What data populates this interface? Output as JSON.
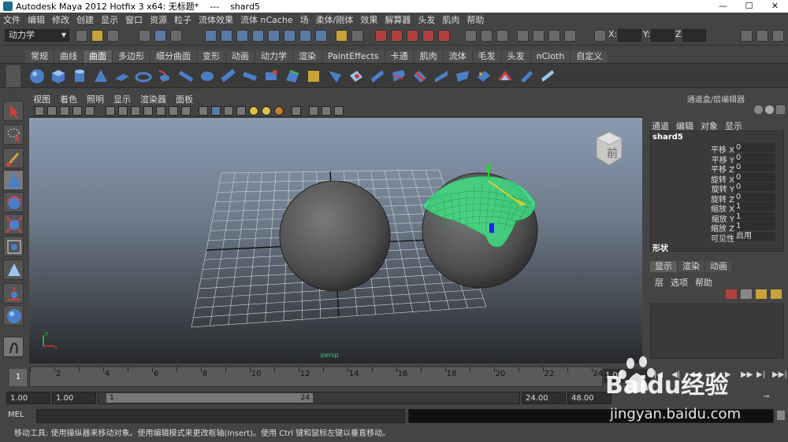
{
  "window": {
    "title": "Autodesk Maya 2012 Hotfix 3 x64: 无标题*    ---    shard5",
    "controls": [
      "—",
      "☐",
      "✕"
    ]
  },
  "menubar": [
    "文件",
    "编辑",
    "修改",
    "创建",
    "显示",
    "窗口",
    "资源",
    "粒子",
    "流体效果",
    "流体 nCache",
    "场",
    "柔体/刚体",
    "效果",
    "解算器",
    "头发",
    "肌肉",
    "帮助"
  ],
  "statusline": {
    "mode": "动力学",
    "x_label": "X:",
    "y_label": "Y:",
    "z_label": "Z:"
  },
  "shelf_tabs": [
    "常规",
    "曲线",
    "曲面",
    "多边形",
    "细分曲面",
    "变形",
    "动画",
    "动力学",
    "渲染",
    "PaintEffects",
    "卡通",
    "肌肉",
    "流体",
    "毛发",
    "头发",
    "nCloth",
    "自定义"
  ],
  "shelf_active": "曲面",
  "panel_menu": [
    "视图",
    "着色",
    "照明",
    "显示",
    "渲染器",
    "面板"
  ],
  "viewport": {
    "viewcube_label": "前",
    "hud_bottom": "persp"
  },
  "channel_box": {
    "title": "通道盒/层编辑器",
    "menu": [
      "通道",
      "编辑",
      "对象",
      "显示"
    ],
    "node": "shard5",
    "attributes": [
      {
        "label": "平移 X",
        "value": "0"
      },
      {
        "label": "平移 Y",
        "value": "0"
      },
      {
        "label": "平移 Z",
        "value": "0"
      },
      {
        "label": "旋转 X",
        "value": "0"
      },
      {
        "label": "旋转 Y",
        "value": "0"
      },
      {
        "label": "旋转 Z",
        "value": "0"
      },
      {
        "label": "缩放 X",
        "value": "1"
      },
      {
        "label": "缩放 Y",
        "value": "1"
      },
      {
        "label": "缩放 Z",
        "value": "1"
      },
      {
        "label": "可见性",
        "value": "启用"
      }
    ],
    "shape_label": "形状"
  },
  "layer_editor": {
    "tabs": [
      "显示",
      "渲染",
      "动画"
    ],
    "menu": [
      "层",
      "选项",
      "帮助"
    ]
  },
  "timeslider": {
    "ticks": [
      "2",
      "4",
      "6",
      "8",
      "10",
      "12",
      "14",
      "16",
      "18",
      "20",
      "22",
      "24"
    ],
    "current_frame": "1",
    "right_value": "1.00"
  },
  "range_slider": {
    "start_time": "1.00",
    "start_range": "1.00",
    "thumb_start": "1",
    "thumb_end": "24",
    "end_range": "24.00",
    "end_time": "48.00"
  },
  "command_line": {
    "mel_label": "MEL"
  },
  "help_line": "移动工具: 使用操纵器来移动对象。使用编辑模式来更改枢轴(Insert)。使用 Ctrl 键和鼠标左键以垂直移动。",
  "watermark": {
    "brand": "Baidu经验",
    "url": "jingyan.baidu.com"
  }
}
